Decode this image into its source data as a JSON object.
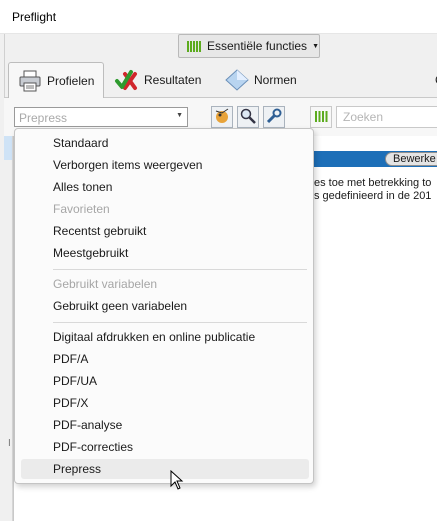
{
  "window": {
    "title": "Preflight"
  },
  "toolbar": {
    "essentials_label": "Essentiële functies"
  },
  "tabs": [
    {
      "label": "Profielen",
      "icon": "printer-icon"
    },
    {
      "label": "Resultaten",
      "icon": "check-x-icon"
    },
    {
      "label": "Normen",
      "icon": "diamond-icon"
    },
    {
      "label": "C",
      "icon": ""
    }
  ],
  "profile_select": {
    "value": "Prepress"
  },
  "search": {
    "placeholder": "Zoeken"
  },
  "panel": {
    "edit_button": "Bewerke",
    "description_lines": [
      "es toe met betrekking to",
      "s gedefinieerd in de 201"
    ]
  },
  "menu": {
    "group1": [
      {
        "label": "Standaard",
        "enabled": true
      },
      {
        "label": "Verborgen items weergeven",
        "enabled": true
      },
      {
        "label": "Alles tonen",
        "enabled": true
      },
      {
        "label": "Favorieten",
        "enabled": false
      },
      {
        "label": "Recentst gebruikt",
        "enabled": true
      },
      {
        "label": "Meestgebruikt",
        "enabled": true
      }
    ],
    "group2": [
      {
        "label": "Gebruikt variabelen",
        "enabled": false
      },
      {
        "label": "Gebruikt geen variabelen",
        "enabled": true
      }
    ],
    "group3": [
      {
        "label": "Digitaal afdrukken en online publicatie",
        "enabled": true
      },
      {
        "label": "PDF/A",
        "enabled": true
      },
      {
        "label": "PDF/UA",
        "enabled": true
      },
      {
        "label": "PDF/X",
        "enabled": true
      },
      {
        "label": "PDF-analyse",
        "enabled": true
      },
      {
        "label": "PDF-correcties",
        "enabled": true
      },
      {
        "label": "Prepress",
        "enabled": true,
        "hovered": true
      }
    ]
  },
  "colors": {
    "accent_green": "#5cab1e",
    "selection_blue": "#1d6fb8"
  }
}
